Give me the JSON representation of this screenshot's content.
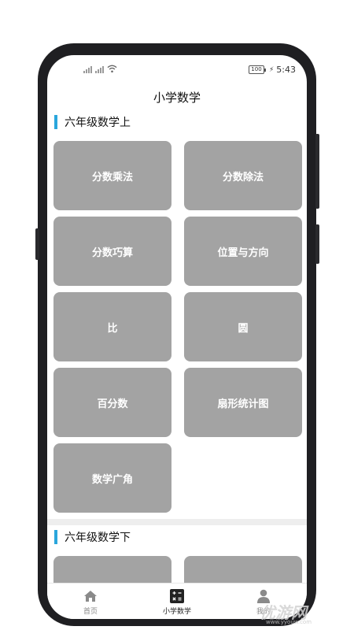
{
  "status": {
    "time": "5:43",
    "battery": "100"
  },
  "header": {
    "title": "小学数学"
  },
  "sections": [
    {
      "title": "六年级数学上",
      "items": [
        "分数乘法",
        "分数除法",
        "分数巧算",
        "位置与方向",
        "比",
        "圆",
        "百分数",
        "扇形统计图",
        "数学广角"
      ]
    },
    {
      "title": "六年级数学下",
      "items": [
        "",
        ""
      ]
    }
  ],
  "tabs": [
    {
      "label": "首页",
      "icon": "home-icon"
    },
    {
      "label": "小学数学",
      "icon": "calculator-icon"
    },
    {
      "label": "我的",
      "icon": "person-icon"
    }
  ],
  "watermark": {
    "text": "优游网",
    "url": "www.yyouw.com"
  },
  "colors": {
    "accent": "#2aa6dc",
    "card": "#a3a3a3"
  }
}
